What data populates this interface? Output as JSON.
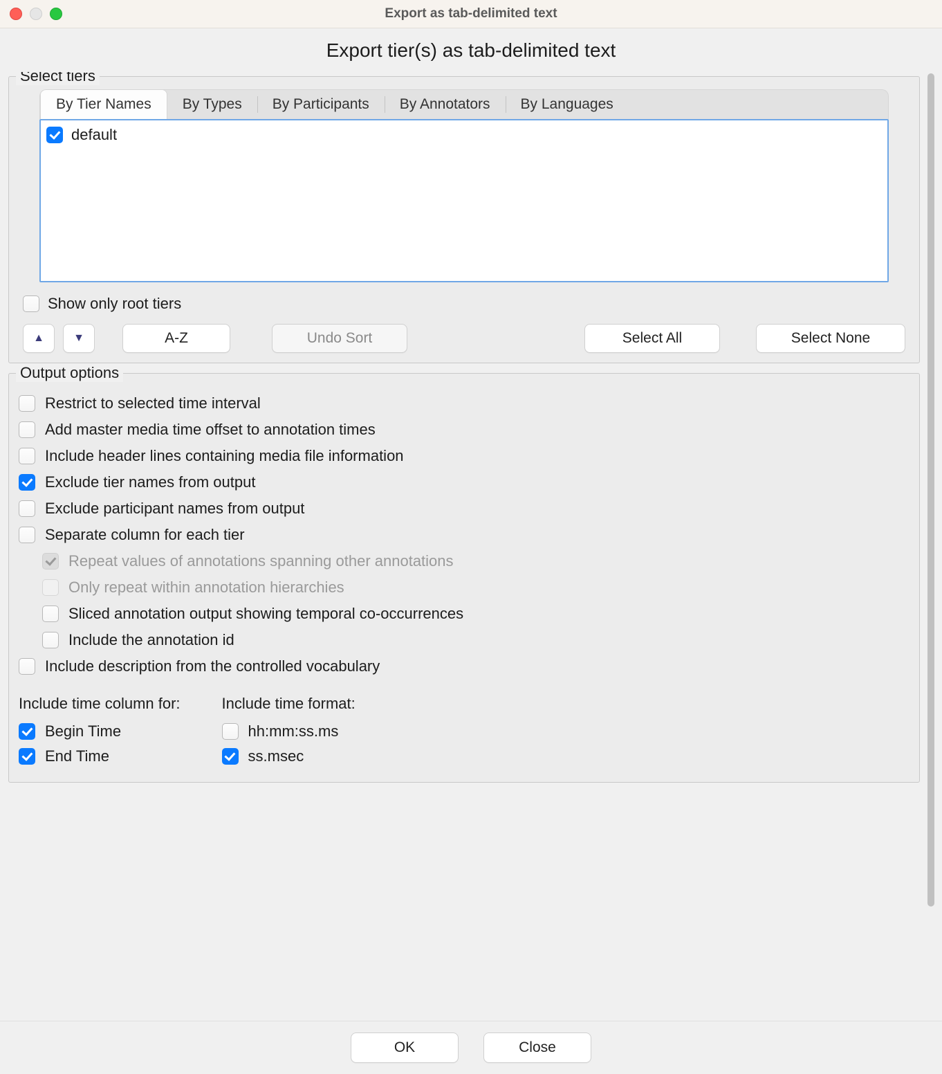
{
  "window": {
    "title": "Export as tab-delimited text",
    "subtitle": "Export tier(s) as tab-delimited text"
  },
  "select_tiers": {
    "group_title": "Select tiers",
    "tabs": [
      {
        "label": "By Tier Names",
        "active": true
      },
      {
        "label": "By Types",
        "active": false
      },
      {
        "label": "By Participants",
        "active": false
      },
      {
        "label": "By Annotators",
        "active": false
      },
      {
        "label": "By Languages",
        "active": false
      }
    ],
    "tiers": [
      {
        "label": "default",
        "checked": true
      }
    ],
    "show_only_root": {
      "label": "Show only root tiers",
      "checked": false
    },
    "sort_buttons": {
      "az": "A-Z",
      "undo": "Undo Sort",
      "select_all": "Select All",
      "select_none": "Select None"
    }
  },
  "output_options": {
    "group_title": "Output options",
    "items": [
      {
        "label": "Restrict to selected time interval",
        "checked": false,
        "indent": 0,
        "disabled": false
      },
      {
        "label": "Add master media time offset to annotation times",
        "checked": false,
        "indent": 0,
        "disabled": false
      },
      {
        "label": "Include header lines containing media file information",
        "checked": false,
        "indent": 0,
        "disabled": false
      },
      {
        "label": "Exclude tier names from output",
        "checked": true,
        "indent": 0,
        "disabled": false
      },
      {
        "label": "Exclude participant names from output",
        "checked": false,
        "indent": 0,
        "disabled": false
      },
      {
        "label": "Separate column for each tier",
        "checked": false,
        "indent": 0,
        "disabled": false
      },
      {
        "label": "Repeat values of annotations spanning other annotations",
        "checked": true,
        "indent": 1,
        "disabled": true
      },
      {
        "label": "Only repeat within annotation hierarchies",
        "checked": false,
        "indent": 1,
        "disabled": true
      },
      {
        "label": "Sliced annotation output showing temporal co-occurrences",
        "checked": false,
        "indent": 1,
        "disabled": false
      },
      {
        "label": "Include the annotation id",
        "checked": false,
        "indent": 1,
        "disabled": false
      },
      {
        "label": "Include description from the controlled vocabulary",
        "checked": false,
        "indent": 0,
        "disabled": false
      }
    ],
    "time_columns": {
      "header": "Include time column for:",
      "items": [
        {
          "label": "Begin Time",
          "checked": true
        },
        {
          "label": "End Time",
          "checked": true
        }
      ]
    },
    "time_format": {
      "header": "Include time format:",
      "items": [
        {
          "label": "hh:mm:ss.ms",
          "checked": false
        },
        {
          "label": "ss.msec",
          "checked": true
        }
      ]
    }
  },
  "footer": {
    "ok": "OK",
    "close": "Close"
  }
}
